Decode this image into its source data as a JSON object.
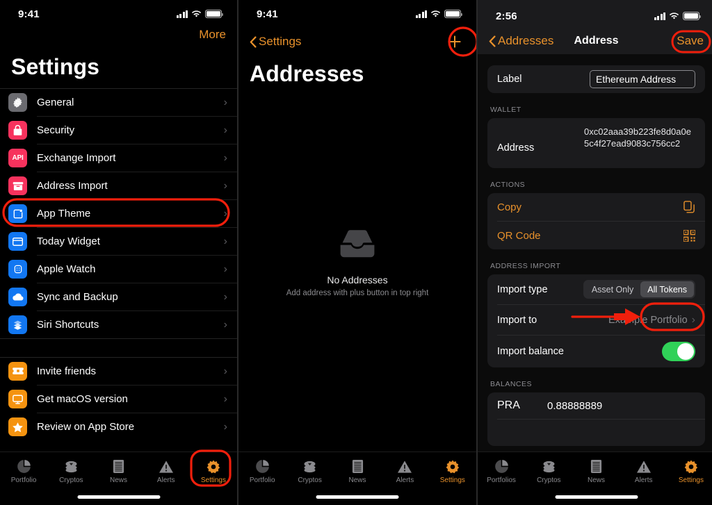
{
  "panel1": {
    "status": {
      "time": "9:41"
    },
    "nav": {
      "more_label": "More",
      "title": "Settings"
    },
    "groups": [
      {
        "items": [
          {
            "label": "General",
            "icon": "gear-icon",
            "color": "#6b6b70"
          },
          {
            "label": "Security",
            "icon": "lock-icon",
            "color": "#f7325d"
          },
          {
            "label": "Exchange Import",
            "icon": "api-icon",
            "color": "#f7325d"
          },
          {
            "label": "Address Import",
            "icon": "archivebox-icon",
            "color": "#f7325d",
            "highlighted": true
          },
          {
            "label": "App Theme",
            "icon": "paintbrush-icon",
            "color": "#1277f2"
          },
          {
            "label": "Today Widget",
            "icon": "widget-icon",
            "color": "#1277f2"
          },
          {
            "label": "Apple Watch",
            "icon": "applewatch-icon",
            "color": "#1277f2"
          },
          {
            "label": "Sync and Backup",
            "icon": "cloud-icon",
            "color": "#1277f2"
          },
          {
            "label": "Siri Shortcuts",
            "icon": "shortcuts-icon",
            "color": "#1277f2"
          }
        ]
      },
      {
        "items": [
          {
            "label": "Invite friends",
            "icon": "ticket-icon",
            "color": "#f59310"
          },
          {
            "label": "Get macOS version",
            "icon": "desktop-icon",
            "color": "#f59310"
          },
          {
            "label": "Review on App Store",
            "icon": "star-icon",
            "color": "#f59310"
          }
        ]
      }
    ],
    "tabs": [
      {
        "label": "Portfolio",
        "icon": "piechart-icon",
        "active": false
      },
      {
        "label": "Cryptos",
        "icon": "coins-icon",
        "active": false
      },
      {
        "label": "News",
        "icon": "news-icon",
        "active": false
      },
      {
        "label": "Alerts",
        "icon": "warning-icon",
        "active": false
      },
      {
        "label": "Settings",
        "icon": "gear-icon",
        "active": true
      }
    ]
  },
  "panel2": {
    "status": {
      "time": "9:41"
    },
    "nav": {
      "back_label": "Settings",
      "title": "Addresses",
      "add_label": "+"
    },
    "empty": {
      "icon": "tray-icon",
      "title": "No Addresses",
      "subtitle": "Add address with plus button in top right"
    },
    "tabs": [
      {
        "label": "Portfolio",
        "icon": "piechart-icon",
        "active": false
      },
      {
        "label": "Cryptos",
        "icon": "coins-icon",
        "active": false
      },
      {
        "label": "News",
        "icon": "news-icon",
        "active": false
      },
      {
        "label": "Alerts",
        "icon": "warning-icon",
        "active": false
      },
      {
        "label": "Settings",
        "icon": "gear-icon",
        "active": true
      }
    ]
  },
  "panel3": {
    "status": {
      "time": "2:56"
    },
    "nav": {
      "back_label": "Addresses",
      "title": "Address",
      "save_label": "Save"
    },
    "label_field": {
      "key": "Label",
      "value": "Ethereum Address"
    },
    "wallet": {
      "header": "WALLET",
      "key": "Address",
      "value": "0xc02aaa39b223fe8d0a0e5c4f27ead9083c756cc2"
    },
    "actions": {
      "header": "ACTIONS",
      "items": [
        {
          "label": "Copy",
          "icon": "copy-icon"
        },
        {
          "label": "QR Code",
          "icon": "qrcode-icon"
        }
      ]
    },
    "address_import": {
      "header": "ADDRESS IMPORT",
      "import_type": {
        "key": "Import type",
        "options": [
          "Asset Only",
          "All Tokens"
        ],
        "selected": "All Tokens"
      },
      "import_to": {
        "key": "Import to",
        "value": "Example Portfolio"
      },
      "import_balance": {
        "key": "Import balance",
        "on": true
      }
    },
    "balances": {
      "header": "BALANCES",
      "rows": [
        {
          "symbol": "PRA",
          "amount": "0.88888889"
        }
      ]
    },
    "tabs": [
      {
        "label": "Portfolios",
        "icon": "piechart-icon",
        "active": false
      },
      {
        "label": "Cryptos",
        "icon": "coins-icon",
        "active": false
      },
      {
        "label": "News",
        "icon": "news-icon",
        "active": false
      },
      {
        "label": "Alerts",
        "icon": "warning-icon",
        "active": false
      },
      {
        "label": "Settings",
        "icon": "gear-icon",
        "active": true
      }
    ]
  },
  "annotations": {
    "color": "#f01f0c",
    "items": [
      {
        "name": "highlight-address-import-row",
        "shape": "rounded-rect"
      },
      {
        "name": "highlight-settings-tab",
        "shape": "rounded-rect"
      },
      {
        "name": "highlight-add-button",
        "shape": "circle"
      },
      {
        "name": "highlight-save-button",
        "shape": "rounded-rect"
      },
      {
        "name": "highlight-all-tokens-option",
        "shape": "rounded-rect"
      },
      {
        "name": "arrow-asset-only-to-all-tokens",
        "shape": "arrow-strikethrough"
      }
    ]
  }
}
